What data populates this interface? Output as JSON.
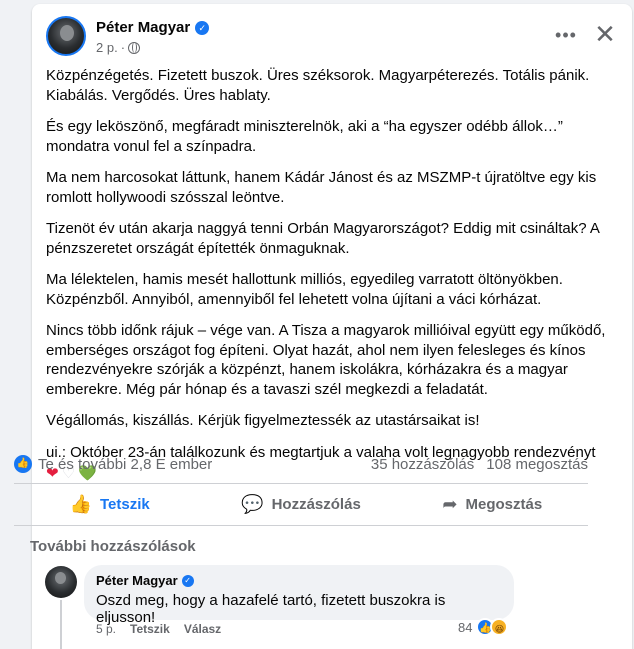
{
  "post": {
    "author": "Péter Magyar",
    "time": "2 p.",
    "paragraphs": [
      "Közpénzégetés. Fizetett buszok. Üres széksorok. Magyarpéterezés. Totális pánik. Kiabálás. Vergődés. Üres hablaty.",
      "És egy leköszönő, megfáradt miniszterelnök, aki a “ha egyszer odébb állok…” mondatra vonul fel a színpadra.",
      "Ma nem harcosokat láttunk, hanem Kádár Jánost és az MSZMP-t újratöltve egy kis romlott hollywoodi szósszal leöntve.",
      "Tizenöt év után akarja naggyá tenni Orbán Magyarországot? Eddig mit csináltak? A pénzszeretet országát építették önmaguknak.",
      "Ma lélektelen, hamis mesét hallottunk milliós, egyedileg varratott öltönyökben. Közpénzből. Annyiból, amennyiből fel lehetett volna újítani a váci kórházat.",
      "Nincs több időnk rájuk – vége van. A Tisza a magyarok millióival együtt egy működő, emberséges országot fog építeni. Olyat hazát, ahol nem ilyen felesleges és kínos rendezvényekre szórják a közpénzt, hanem iskolákra, kórházakra és a magyar emberekre. Még pár hónap és a tavaszi szél megkezdi a feladatát.",
      "Végállomás, kiszállás. Kérjük figyelmeztessék az utastársaikat is!",
      "ui.: Október 23-án találkozunk és megtartjuk a valaha volt legnagyobb rendezvényt"
    ],
    "hearts": [
      "❤",
      "♡",
      "💚"
    ]
  },
  "stats": {
    "reactions": "Te és további 2,8 E ember",
    "comments": "35 hozzászólás",
    "shares": "108 megosztás"
  },
  "actions": {
    "like": "Tetszik",
    "comment": "Hozzászólás",
    "share": "Megosztás"
  },
  "comments_section": {
    "more_label": "További hozzászólások",
    "comment": {
      "author": "Péter Magyar",
      "text": "Oszd meg, hogy a hazafelé tartó, fizetett buszokra is eljusson!",
      "time": "5 p.",
      "like": "Tetszik",
      "reply": "Válasz",
      "reaction_count": "84"
    }
  },
  "icons": {
    "more": "more-horizontal-icon",
    "close": "close-icon",
    "globe": "globe-icon",
    "like": "thumbs-up-icon",
    "comment": "comment-bubble-icon",
    "share": "share-arrow-icon"
  },
  "colors": {
    "accent": "#1877f2",
    "muted": "#65676b",
    "background": "#f0f2f5"
  }
}
